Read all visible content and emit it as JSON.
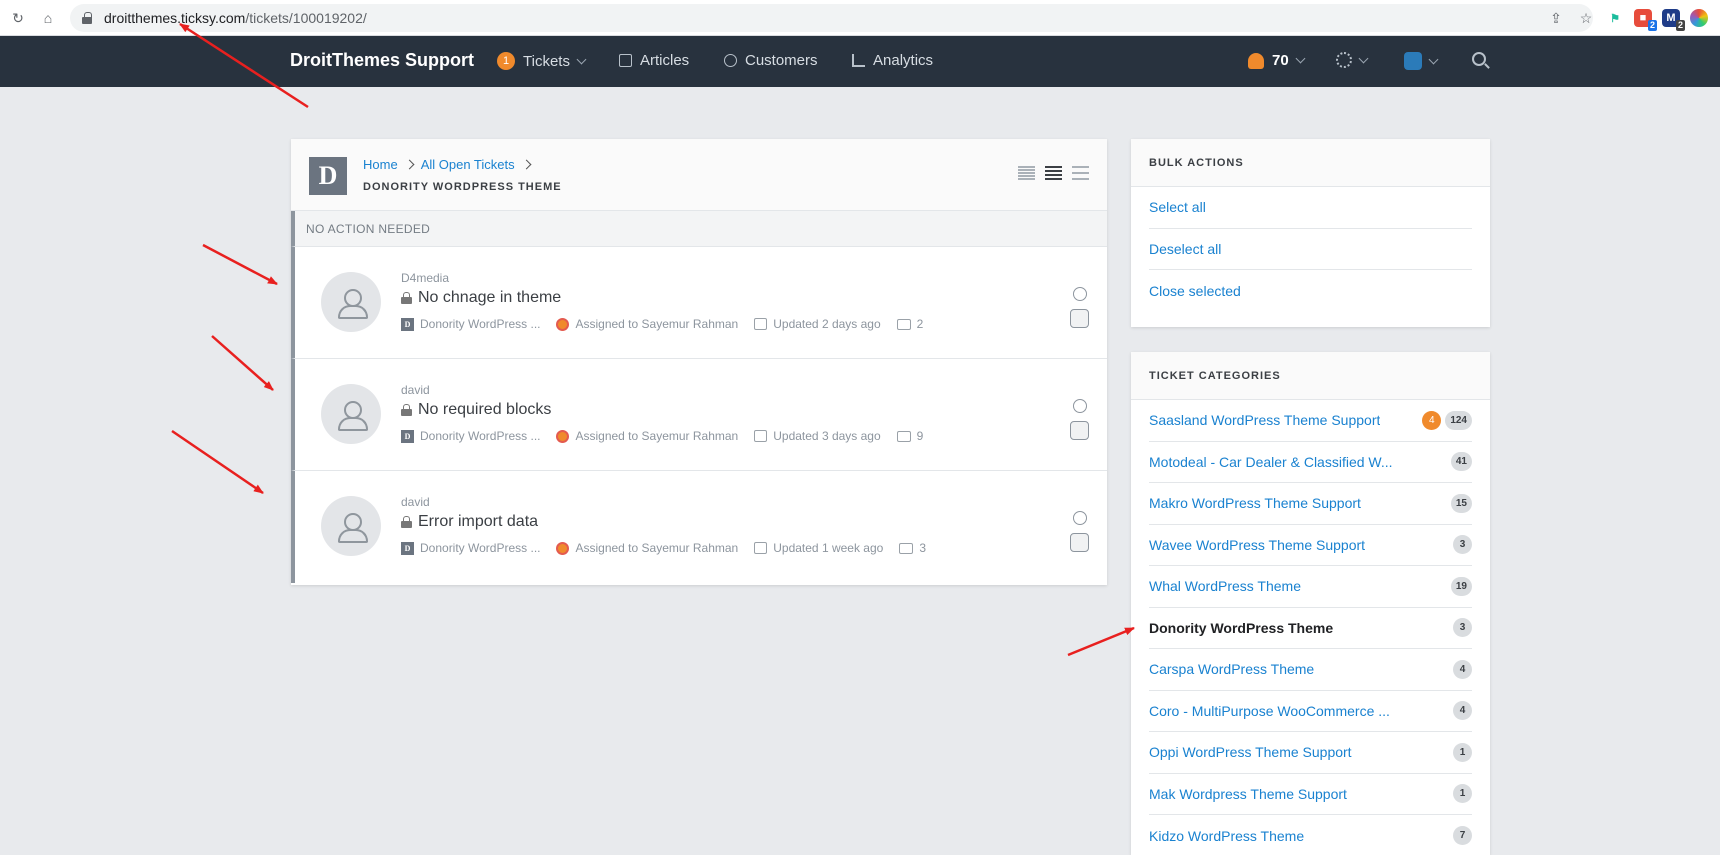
{
  "browser": {
    "url_host": "droitthemes.ticksy.com",
    "url_path": "/tickets/100019202/",
    "ext_badge_1": "2",
    "ext_badge_2": "2"
  },
  "navbar": {
    "brand": "DroitThemes Support",
    "tickets_count": "1",
    "tickets_label": "Tickets",
    "articles_label": "Articles",
    "customers_label": "Customers",
    "analytics_label": "Analytics",
    "notifications_count": "70"
  },
  "main": {
    "logo_letter": "D",
    "breadcrumb": {
      "home": "Home",
      "all_open": "All Open Tickets"
    },
    "title": "DONORITY WORDPRESS THEME",
    "section_label": "NO ACTION NEEDED",
    "tickets": [
      {
        "author": "D4media",
        "title": "No chnage in theme",
        "category": "Donority WordPress ...",
        "assigned": "Assigned to Sayemur Rahman",
        "updated": "Updated 2 days ago",
        "comments": "2"
      },
      {
        "author": "david",
        "title": "No required blocks",
        "category": "Donority WordPress ...",
        "assigned": "Assigned to Sayemur Rahman",
        "updated": "Updated 3 days ago",
        "comments": "9"
      },
      {
        "author": "david",
        "title": "Error import data",
        "category": "Donority WordPress ...",
        "assigned": "Assigned to Sayemur Rahman",
        "updated": "Updated 1 week ago",
        "comments": "3"
      }
    ]
  },
  "bulk_actions": {
    "heading": "BULK ACTIONS",
    "select_all": "Select all",
    "deselect_all": "Deselect all",
    "close_selected": "Close selected"
  },
  "categories": {
    "heading": "TICKET CATEGORIES",
    "items": [
      {
        "name": "Saasland WordPress Theme Support",
        "unread": "4",
        "total": "124"
      },
      {
        "name": "Motodeal - Car Dealer & Classified W...",
        "total": "41"
      },
      {
        "name": "Makro WordPress Theme Support",
        "total": "15"
      },
      {
        "name": "Wavee WordPress Theme Support",
        "total": "3"
      },
      {
        "name": "Whal WordPress Theme",
        "total": "19"
      },
      {
        "name": "Donority WordPress Theme",
        "total": "3"
      },
      {
        "name": "Carspa WordPress Theme",
        "total": "4"
      },
      {
        "name": "Coro - MultiPurpose WooCommerce ...",
        "total": "4"
      },
      {
        "name": "Oppi WordPress Theme Support",
        "total": "1"
      },
      {
        "name": "Mak Wordpress Theme Support",
        "total": "1"
      },
      {
        "name": "Kidzo WordPress Theme",
        "total": "7"
      }
    ]
  },
  "colors": {
    "accent": "#1a82d0",
    "navbar": "#28323e",
    "badge": "#f08a2c",
    "annotation": "#e8201f"
  }
}
